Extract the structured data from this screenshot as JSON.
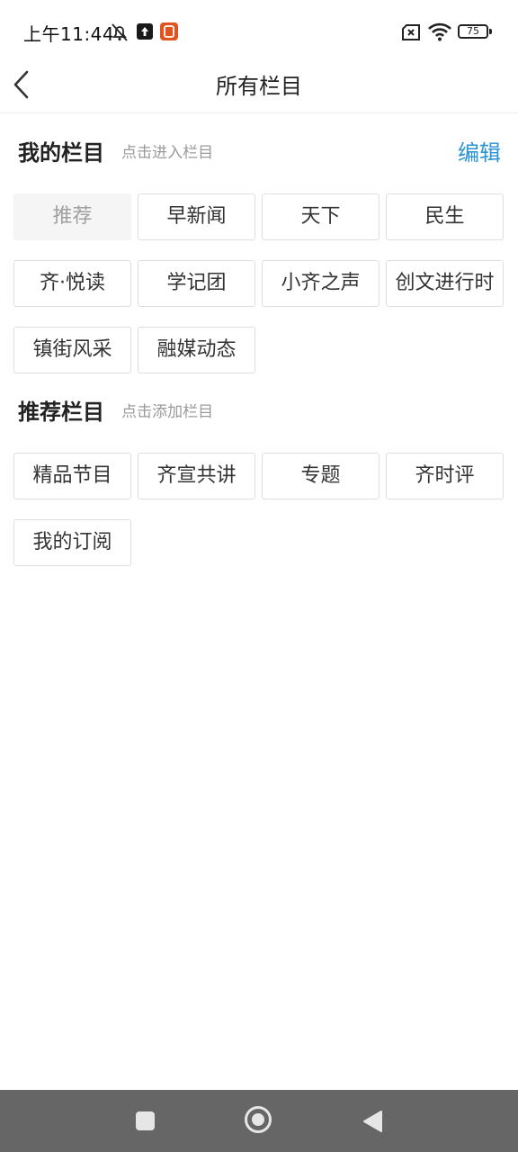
{
  "status_bar": {
    "time": "上午11:44",
    "battery": "75"
  },
  "header": {
    "title": "所有栏目"
  },
  "my_channels": {
    "title": "我的栏目",
    "hint": "点击进入栏目",
    "edit_label": "编辑",
    "items": [
      "推荐",
      "早新闻",
      "天下",
      "民生",
      "齐·悦读",
      "学记团",
      "小齐之声",
      "创文进行时",
      "镇街风采",
      "融媒动态"
    ]
  },
  "recommended_channels": {
    "title": "推荐栏目",
    "hint": "点击添加栏目",
    "items": [
      "精品节目",
      "齐宣共讲",
      "专题",
      "齐时评",
      "我的订阅"
    ]
  },
  "colors": {
    "accent": "#2c93d3",
    "nav_bar": "#666666"
  }
}
